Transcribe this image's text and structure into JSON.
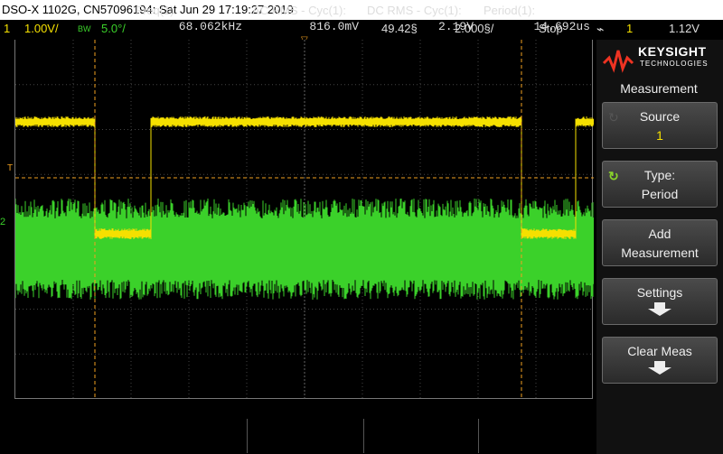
{
  "title_bar": {
    "text": "DSO-X 1102G, CN57096194: Sat Jun 29 17:19:27 2019"
  },
  "status_bar": {
    "ch1_number": "1",
    "ch1_scale": "1.00V/",
    "bw_label": "BW",
    "ch2_scale": "5.0°/",
    "time_offset": "49.42§",
    "time_scale": "2.000§/",
    "run_state": "Stop",
    "trigger_icon": "trigger-edge-icon",
    "trigger_channel": "1",
    "trigger_level": "1.12V"
  },
  "screen": {
    "trigger_marker": "T",
    "ch2_marker": "2",
    "colors": {
      "ch1": "#f5e000",
      "ch2": "#3bd12a",
      "cursor": "#f0a020",
      "grid": "#444444"
    }
  },
  "brand": {
    "name": "KEYSIGHT",
    "sub": "TECHNOLOGIES"
  },
  "side_menu": {
    "title": "Measurement",
    "source": {
      "line1": "Source",
      "line2": "1"
    },
    "type": {
      "line1": "Type:",
      "line2": "Period"
    },
    "add": {
      "line1": "Add",
      "line2": "Measurement"
    },
    "settings": {
      "line1": "Settings"
    },
    "clear": {
      "line1": "Clear Meas"
    }
  },
  "measurements": [
    {
      "label": "Freq(1):",
      "value": "68.062kHz"
    },
    {
      "label": "AC RMS - Cyc(1):",
      "value": "816.0mV"
    },
    {
      "label": "DC RMS - Cyc(1):",
      "value": "2.19V"
    },
    {
      "label": "Period(1):",
      "value": "14.692us"
    }
  ]
}
